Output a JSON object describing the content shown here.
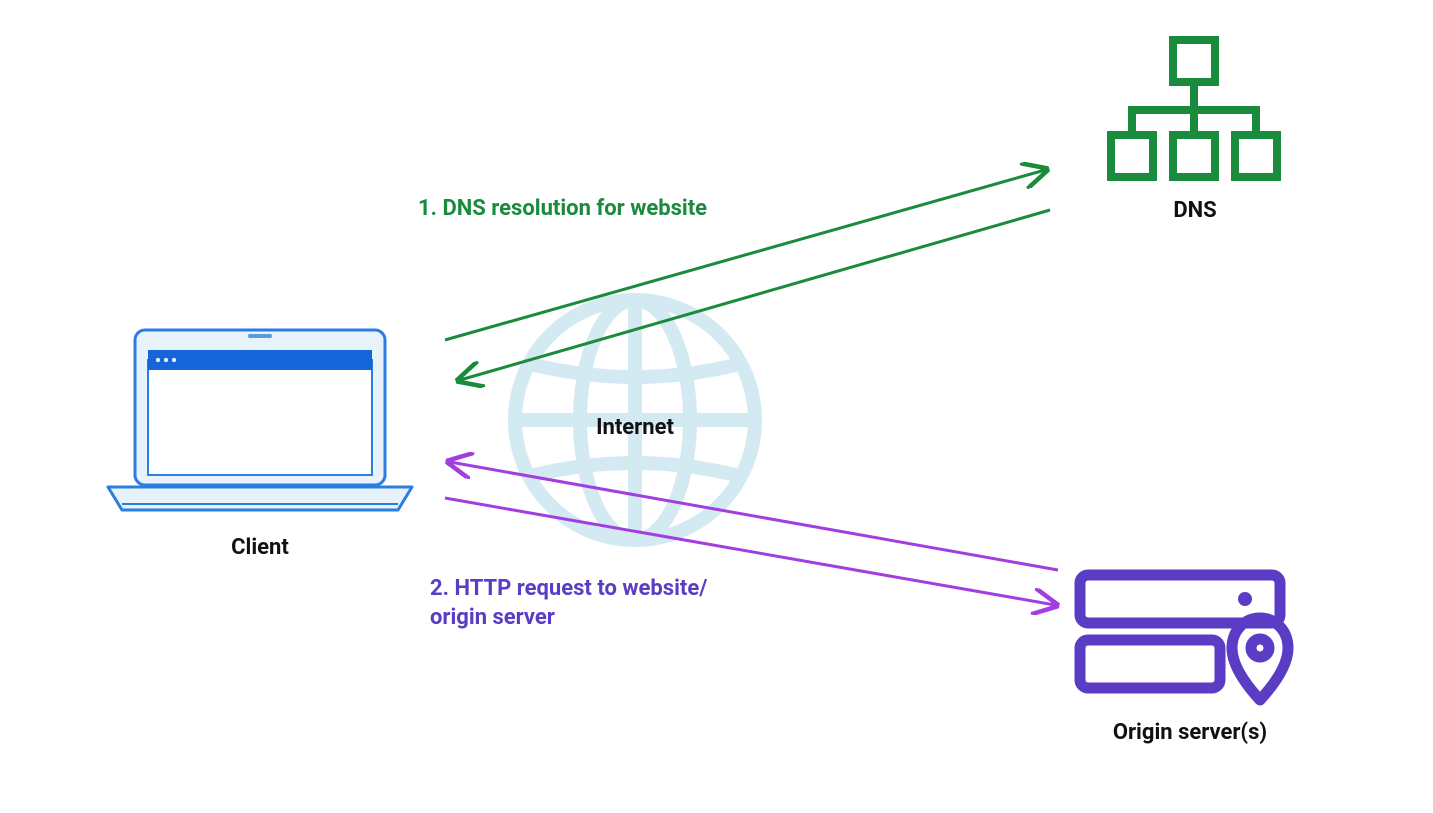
{
  "nodes": {
    "client": {
      "label": "Client"
    },
    "dns": {
      "label": "DNS"
    },
    "internet": {
      "label": "Internet"
    },
    "origin": {
      "label": "Origin server(s)"
    }
  },
  "flows": {
    "dns_resolution": {
      "label": "1. DNS resolution for website"
    },
    "http_request": {
      "label_line1": "2. HTTP request to website/",
      "label_line2": "origin server"
    }
  },
  "colors": {
    "client_stroke": "#2a7de1",
    "client_fill": "#e7f2fb",
    "client_bar": "#1565d8",
    "dns_stroke": "#1a8a3d",
    "globe_stroke": "#cfe8f2",
    "origin_stroke": "#5b3cc4",
    "arrow_green": "#1a8a3d",
    "arrow_purple": "#a23ee0"
  }
}
